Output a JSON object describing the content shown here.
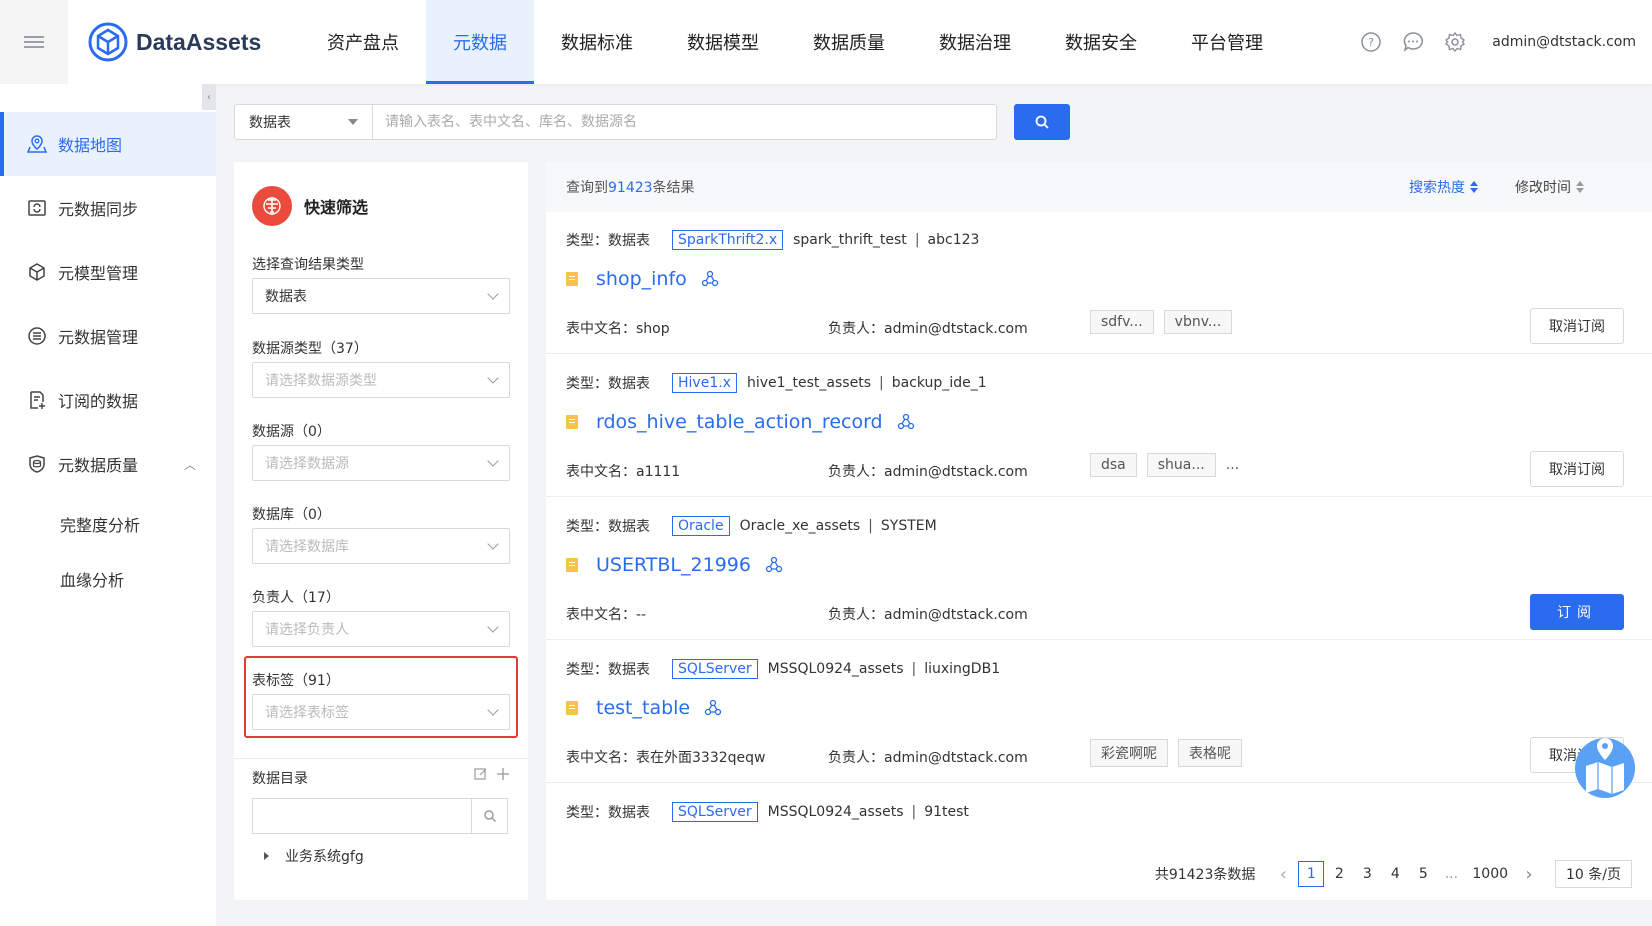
{
  "header": {
    "app_name": "DataAssets",
    "nav": [
      "资产盘点",
      "元数据",
      "数据标准",
      "数据模型",
      "数据质量",
      "数据治理",
      "数据安全",
      "平台管理"
    ],
    "active_nav": "元数据",
    "user": "admin@dtstack.com"
  },
  "sidebar": {
    "items": [
      {
        "label": "数据地图",
        "icon": "map-icon",
        "active": true
      },
      {
        "label": "元数据同步",
        "icon": "sync-icon"
      },
      {
        "label": "元模型管理",
        "icon": "cube-icon"
      },
      {
        "label": "元数据管理",
        "icon": "database-icon"
      },
      {
        "label": "订阅的数据",
        "icon": "subscribe-icon"
      },
      {
        "label": "元数据质量",
        "icon": "quality-icon"
      }
    ],
    "sub_items": [
      "完整度分析",
      "血缘分析"
    ]
  },
  "search": {
    "type": "数据表",
    "placeholder": "请输入表名、表中文名、库名、数据源名"
  },
  "filter": {
    "title": "快速筛选",
    "result_type_label": "选择查询结果类型",
    "result_type_value": "数据表",
    "ds_type_label": "数据源类型（37）",
    "ds_type_placeholder": "请选择数据源类型",
    "ds_label": "数据源（0）",
    "ds_placeholder": "请选择数据源",
    "db_label": "数据库（0）",
    "db_placeholder": "请选择数据库",
    "owner_label": "负责人（17）",
    "owner_placeholder": "请选择负责人",
    "tag_label": "表标签（91）",
    "tag_placeholder": "请选择表标签",
    "dir_label": "数据目录",
    "tree_node": "业务系统gfg"
  },
  "results": {
    "prefix": "查询到",
    "count": "91423",
    "suffix": "条结果",
    "sort_hot": "搜索热度",
    "sort_modified": "修改时间",
    "type_label": "类型：",
    "cn_label": "表中文名：",
    "owner_label": "负责人：",
    "items": [
      {
        "type": "数据表",
        "source": "SparkThrift2.x",
        "db": "spark_thrift_test",
        "schema": "abc123",
        "name": "shop_info",
        "cn_name": "shop",
        "owner": "admin@dtstack.com",
        "tags": [
          "sdfv...",
          "vbnv..."
        ],
        "more": "",
        "action": "取消订阅"
      },
      {
        "type": "数据表",
        "source": "Hive1.x",
        "db": "hive1_test_assets",
        "schema": "backup_ide_1",
        "name": "rdos_hive_table_action_record",
        "cn_name": "a1111",
        "owner": "admin@dtstack.com",
        "tags": [
          "dsa",
          "shua..."
        ],
        "more": "...",
        "action": "取消订阅"
      },
      {
        "type": "数据表",
        "source": "Oracle",
        "db": "Oracle_xe_assets",
        "schema": "SYSTEM",
        "name": "USERTBL_21996",
        "cn_name": "--",
        "owner": "admin@dtstack.com",
        "tags": [],
        "more": "",
        "action": "订阅"
      },
      {
        "type": "数据表",
        "source": "SQLServer",
        "db": "MSSQL0924_assets",
        "schema": "liuxingDB1",
        "name": "test_table",
        "cn_name": "表在外面3332qeqw",
        "owner": "admin@dtstack.com",
        "tags": [
          "彩瓷啊呢",
          "表格呢"
        ],
        "more": "",
        "action": "取消订阅"
      },
      {
        "type": "数据表",
        "source": "SQLServer",
        "db": "MSSQL0924_assets",
        "schema": "91test",
        "name": "",
        "cn_name": "",
        "owner": "",
        "tags": [],
        "more": "",
        "action": ""
      }
    ]
  },
  "pagination": {
    "total": "共91423条数据",
    "pages": [
      "1",
      "2",
      "3",
      "4",
      "5",
      "...",
      "1000"
    ],
    "current": "1",
    "page_size": "10 条/页"
  },
  "colors": {
    "primary": "#2a6cf0",
    "highlight": "#e53935",
    "filter_logo": "#ea4b3d"
  }
}
